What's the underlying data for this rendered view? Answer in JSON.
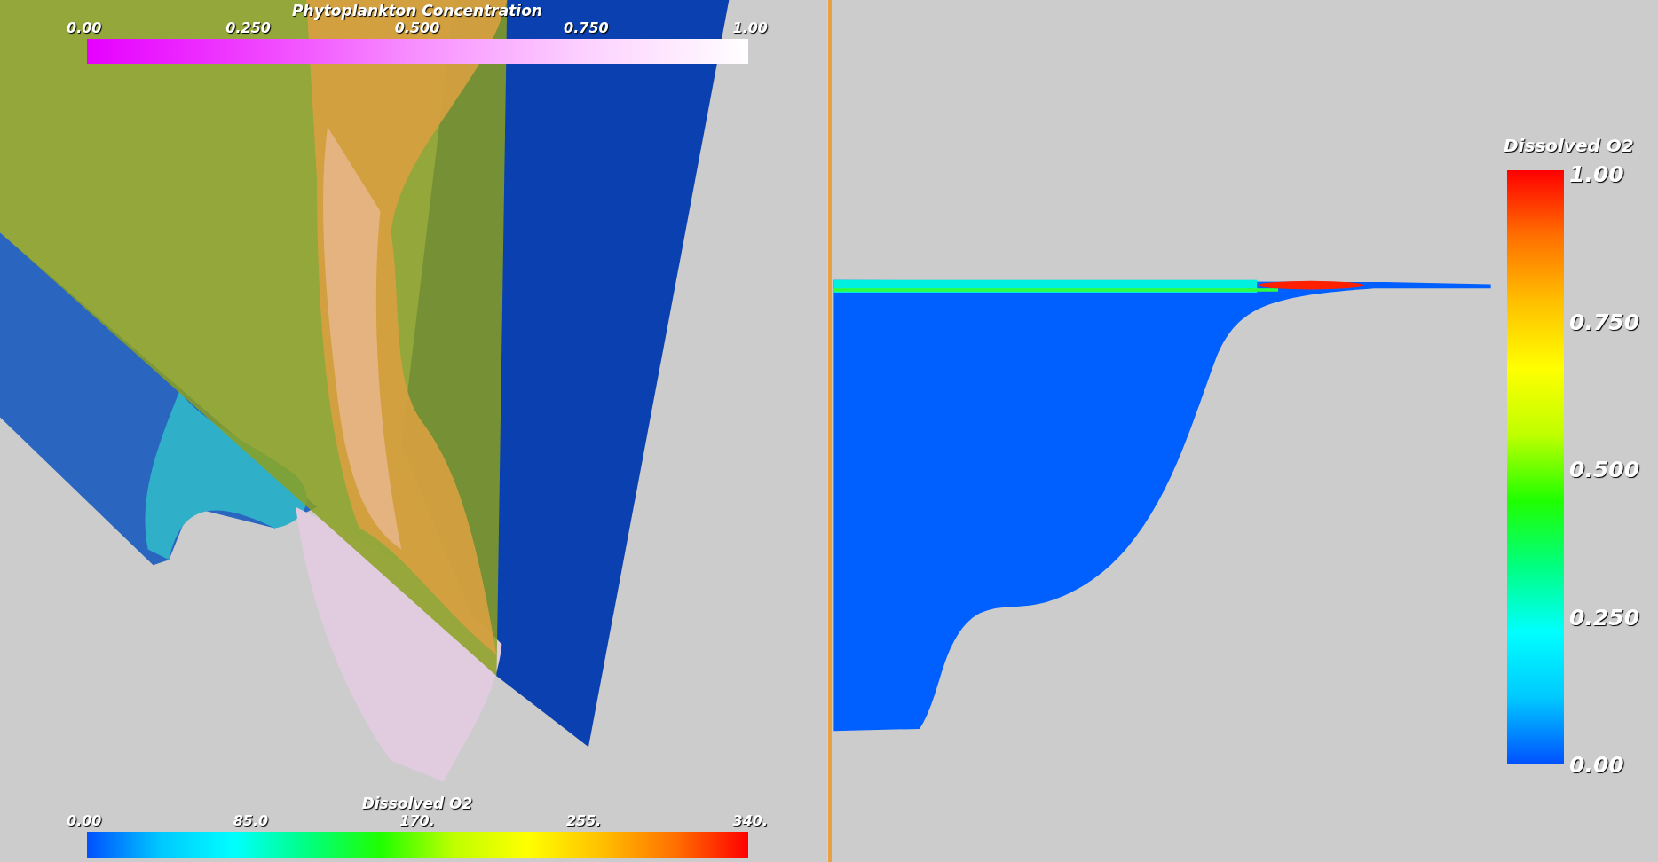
{
  "views": [
    {
      "kind": "render-3d",
      "legends": [
        {
          "kind": "magenta",
          "title": "Phytoplankton Concentration",
          "labels": [
            "0.00",
            "0.250",
            "0.500",
            "0.750",
            "1.00"
          ]
        },
        {
          "kind": "rainbow",
          "title": "Dissolved O2",
          "labels": [
            "0.00",
            "85.0",
            "170.",
            "255.",
            "340."
          ]
        }
      ]
    },
    {
      "kind": "slice",
      "legends": [
        {
          "kind": "column",
          "title": "Dissolved O2",
          "labels": [
            "1.00",
            "0.750",
            "0.500",
            "0.250",
            "0.00"
          ]
        }
      ]
    }
  ]
}
